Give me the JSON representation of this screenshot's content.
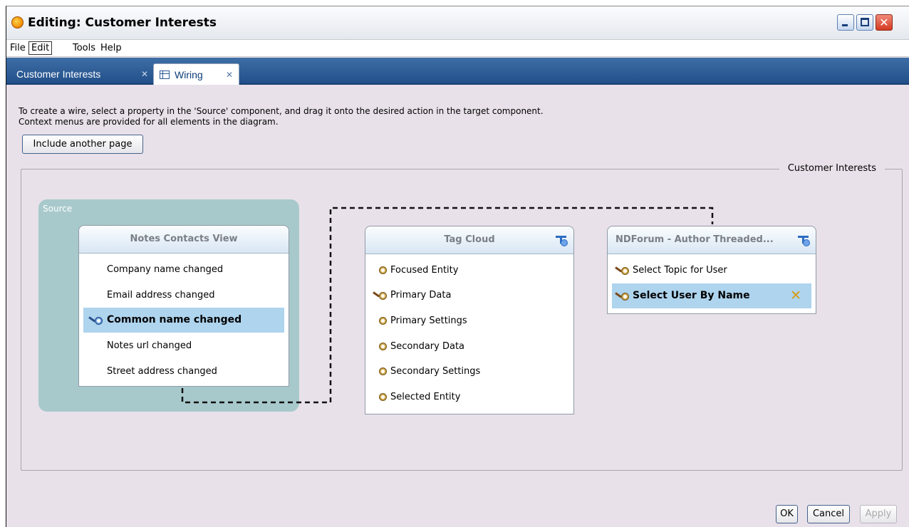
{
  "window": {
    "title": "Editing: Customer Interests",
    "icon": "app-logo-icon"
  },
  "menu": [
    "File",
    "Edit",
    "Tools",
    "Help"
  ],
  "tabs": [
    {
      "label": "Customer Interests",
      "close": "✕"
    },
    {
      "label": "Wiring",
      "close": "✕"
    }
  ],
  "instructions": {
    "line1": "To create a wire, select a property in the 'Source' component, and drag it onto the desired action in the target component.",
    "line2": "Context menus are provided for all elements in the diagram."
  },
  "include_button": "Include another page",
  "canvas": {
    "legend": "Customer Interests",
    "source_label": "Source"
  },
  "panels": {
    "notes_contacts": {
      "title": "Notes Contacts View",
      "items": [
        "Company name changed",
        "Email address changed",
        "Common name changed",
        "Notes url changed",
        "Street address changed"
      ],
      "selected_index": 2
    },
    "tag_cloud": {
      "title": "Tag Cloud",
      "items": [
        "Focused Entity",
        "Primary Data",
        "Primary Settings",
        "Secondary Data",
        "Secondary Settings",
        "Selected Entity"
      ]
    },
    "ndforum": {
      "title": "NDForum - Author Threaded...",
      "items": [
        "Select Topic for User",
        "Select User By Name"
      ],
      "selected_index": 1
    }
  },
  "footer": {
    "ok": "OK",
    "cancel": "Cancel",
    "apply": "Apply"
  },
  "colors": {
    "background": "#e9e1ea",
    "tab_bar": "#2d5c96",
    "selected_row": "#aed4ee",
    "source_zone": "#a8c9cc"
  }
}
